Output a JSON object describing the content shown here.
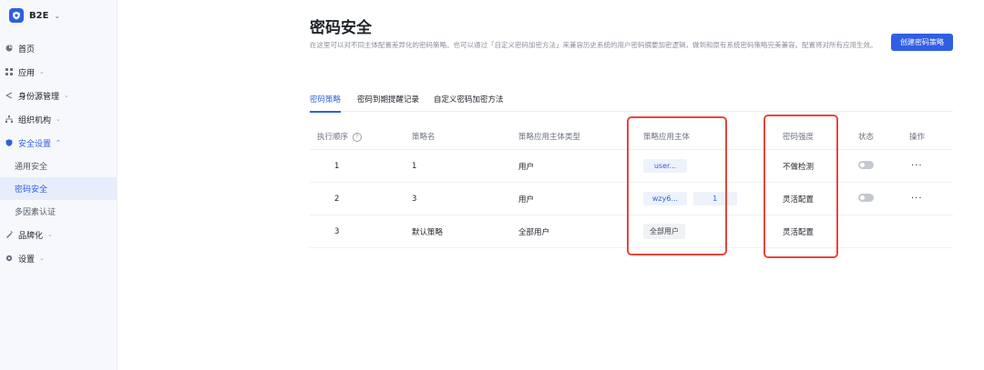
{
  "sidebar": {
    "brand": "B2E",
    "items": [
      {
        "label": "首页"
      },
      {
        "label": "应用"
      },
      {
        "label": "身份源管理"
      },
      {
        "label": "组织机构"
      },
      {
        "label": "安全设置"
      },
      {
        "label": "品牌化"
      },
      {
        "label": "设置"
      }
    ],
    "security_sub": [
      {
        "label": "通用安全"
      },
      {
        "label": "密码安全"
      },
      {
        "label": "多因素认证"
      }
    ]
  },
  "header": {
    "title": "密码安全",
    "description": "在这里可以对不同主体配置差异化的密码策略。也可以通过「自定义密码加密方法」来兼容历史系统的用户密码摘要加密逻辑，做到和原有系统密码策略完美兼容。配置将对所有应用生效。",
    "create_button": "创建密码策略"
  },
  "tabs": [
    {
      "label": "密码策略"
    },
    {
      "label": "密码到期提醒记录"
    },
    {
      "label": "自定义密码加密方法"
    }
  ],
  "table": {
    "columns": [
      "执行顺序",
      "策略名",
      "策略应用主体类型",
      "策略应用主体",
      "密码强度",
      "状态",
      "操作"
    ],
    "help_icon": "?",
    "rows": [
      {
        "order": "1",
        "name": "1",
        "subject_type": "用户",
        "subjects": [
          "user..."
        ],
        "strength": "不做检测",
        "action": "···"
      },
      {
        "order": "2",
        "name": "3",
        "subject_type": "用户",
        "subjects": [
          "wzy6...",
          "1"
        ],
        "strength": "灵活配置",
        "action": "···"
      },
      {
        "order": "3",
        "name": "默认策略",
        "subject_type": "全部用户",
        "subjects": [
          "全部用户"
        ],
        "strength": "灵活配置",
        "action": ""
      }
    ]
  },
  "colors": {
    "accent": "#2f5fe3",
    "highlight": "#e8453c",
    "sidebar_bg": "#f6f8fb"
  }
}
